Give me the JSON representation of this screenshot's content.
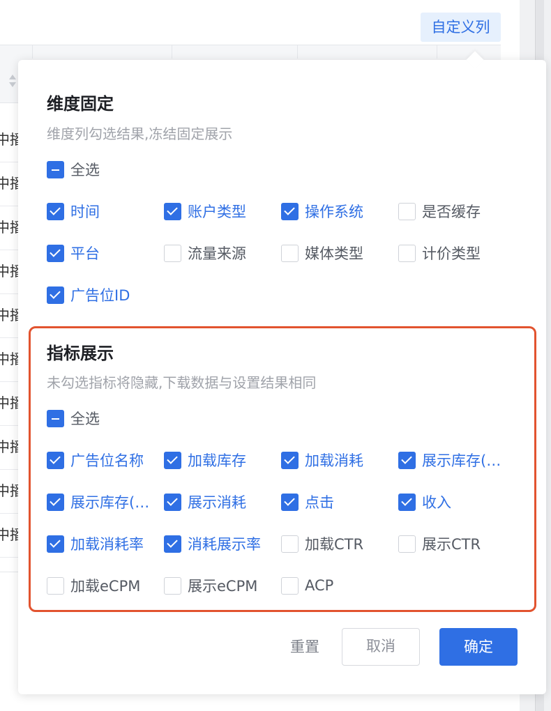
{
  "header": {
    "custom_columns_label": "自定义列"
  },
  "background_table": {
    "row_fragment": "中播",
    "row_count": 10
  },
  "dimension_section": {
    "title": "维度固定",
    "description": "维度列勾选结果,冻结固定展示",
    "select_all_label": "全选",
    "select_all_state": "indeterminate",
    "options": [
      {
        "label": "时间",
        "checked": true
      },
      {
        "label": "账户类型",
        "checked": true
      },
      {
        "label": "操作系统",
        "checked": true
      },
      {
        "label": "是否缓存",
        "checked": false
      },
      {
        "label": "平台",
        "checked": true
      },
      {
        "label": "流量来源",
        "checked": false
      },
      {
        "label": "媒体类型",
        "checked": false
      },
      {
        "label": "计价类型",
        "checked": false
      },
      {
        "label": "广告位ID",
        "checked": true
      }
    ]
  },
  "metric_section": {
    "title": "指标展示",
    "description": "未勾选指标将隐藏,下载数据与设置结果相同",
    "select_all_label": "全选",
    "select_all_state": "indeterminate",
    "options": [
      {
        "label": "广告位名称",
        "checked": true
      },
      {
        "label": "加载库存",
        "checked": true
      },
      {
        "label": "加载消耗",
        "checked": true
      },
      {
        "label": "展示库存(…",
        "checked": true
      },
      {
        "label": "展示库存(…",
        "checked": true
      },
      {
        "label": "展示消耗",
        "checked": true
      },
      {
        "label": "点击",
        "checked": true
      },
      {
        "label": "收入",
        "checked": true
      },
      {
        "label": "加载消耗率",
        "checked": true
      },
      {
        "label": "消耗展示率",
        "checked": true
      },
      {
        "label": "加载CTR",
        "checked": false
      },
      {
        "label": "展示CTR",
        "checked": false
      },
      {
        "label": "加载eCPM",
        "checked": false
      },
      {
        "label": "展示eCPM",
        "checked": false
      },
      {
        "label": "ACP",
        "checked": false
      }
    ]
  },
  "footer": {
    "reset_label": "重置",
    "cancel_label": "取消",
    "confirm_label": "确定"
  },
  "colors": {
    "primary": "#2f6fe4",
    "highlight": "#e2532f"
  }
}
